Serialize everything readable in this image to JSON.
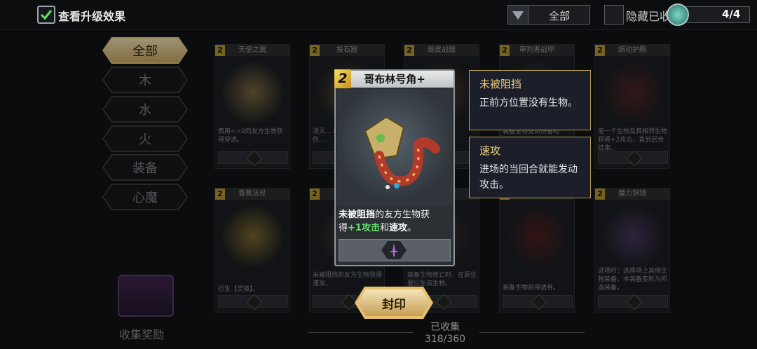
{
  "topbar": {
    "show_upgrade_label": "查看升级效果",
    "filter_selected": "全部",
    "hide_collected_label": "隐藏已收",
    "page_indicator": "4/4"
  },
  "nav": {
    "items": [
      {
        "label": "全部",
        "active": true
      },
      {
        "label": "木",
        "active": false
      },
      {
        "label": "水",
        "active": false
      },
      {
        "label": "火",
        "active": false
      },
      {
        "label": "装备",
        "active": false
      },
      {
        "label": "心魔",
        "active": false
      }
    ]
  },
  "cards": [
    {
      "cost": "2",
      "name": "天使之翼",
      "desc": "费用<=2的友方生物获得穿透。",
      "color": "#caa45a"
    },
    {
      "cost": "2",
      "name": "投石器",
      "desc": "消灭... 给对手... 上的伤...",
      "color": "#8a6a3a"
    },
    {
      "cost": "2",
      "name": "兽皮战鼓",
      "desc": "...攻击",
      "color": "#7a5530"
    },
    {
      "cost": "2",
      "name": "审判者战甲",
      "desc": "装备生物受到伤害时",
      "color": "#6a6a72"
    },
    {
      "cost": "2",
      "name": "煽动护腕",
      "desc": "使一个生物及其相邻生物获得+2攻击，直到回合结束。",
      "color": "#7a2a2a"
    },
    {
      "cost": "2",
      "name": "香蕉法杖",
      "desc": "衍生【灵猿】。",
      "color": "#c9a53a"
    },
    {
      "cost": "2",
      "name": "",
      "desc": "未被阻挡的友方生物获得速攻。",
      "color": "#5a4a3a"
    },
    {
      "cost": "2",
      "name": "",
      "desc": "装备生物死亡时，在原位置衍生该生物。",
      "color": "#5a3a3a"
    },
    {
      "cost": "2",
      "name": "",
      "desc": "装备生物获得透骨。",
      "color": "#7a2020"
    },
    {
      "cost": "2",
      "name": "魔力铜镜",
      "desc": "进场时：选择场上其他生物装备，本装备变形为所选装备。",
      "color": "#6a4a8a"
    }
  ],
  "popup": {
    "cost": "2",
    "title": "哥布林号角+",
    "text_blocked": "未被阻挡",
    "text_mid1": "的友方生物获",
    "text_mid2": "得",
    "text_bonus": "+1攻击",
    "text_and": "和",
    "text_haste": "速攻",
    "text_end": "。"
  },
  "tooltips": [
    {
      "title": "未被阻挡",
      "body": "正前方位置没有生物。"
    },
    {
      "title": "速攻",
      "body": "进场的当回合就能发动攻击。"
    }
  ],
  "seal_button": "封印",
  "collection": {
    "label": "已收集",
    "count": "318/360"
  },
  "collect_reward_label": "收集奖励",
  "colors": {
    "accent_gold": "#e7c873",
    "tooltip_title": "#f0d27b",
    "bonus_green": "#5fe06a"
  }
}
